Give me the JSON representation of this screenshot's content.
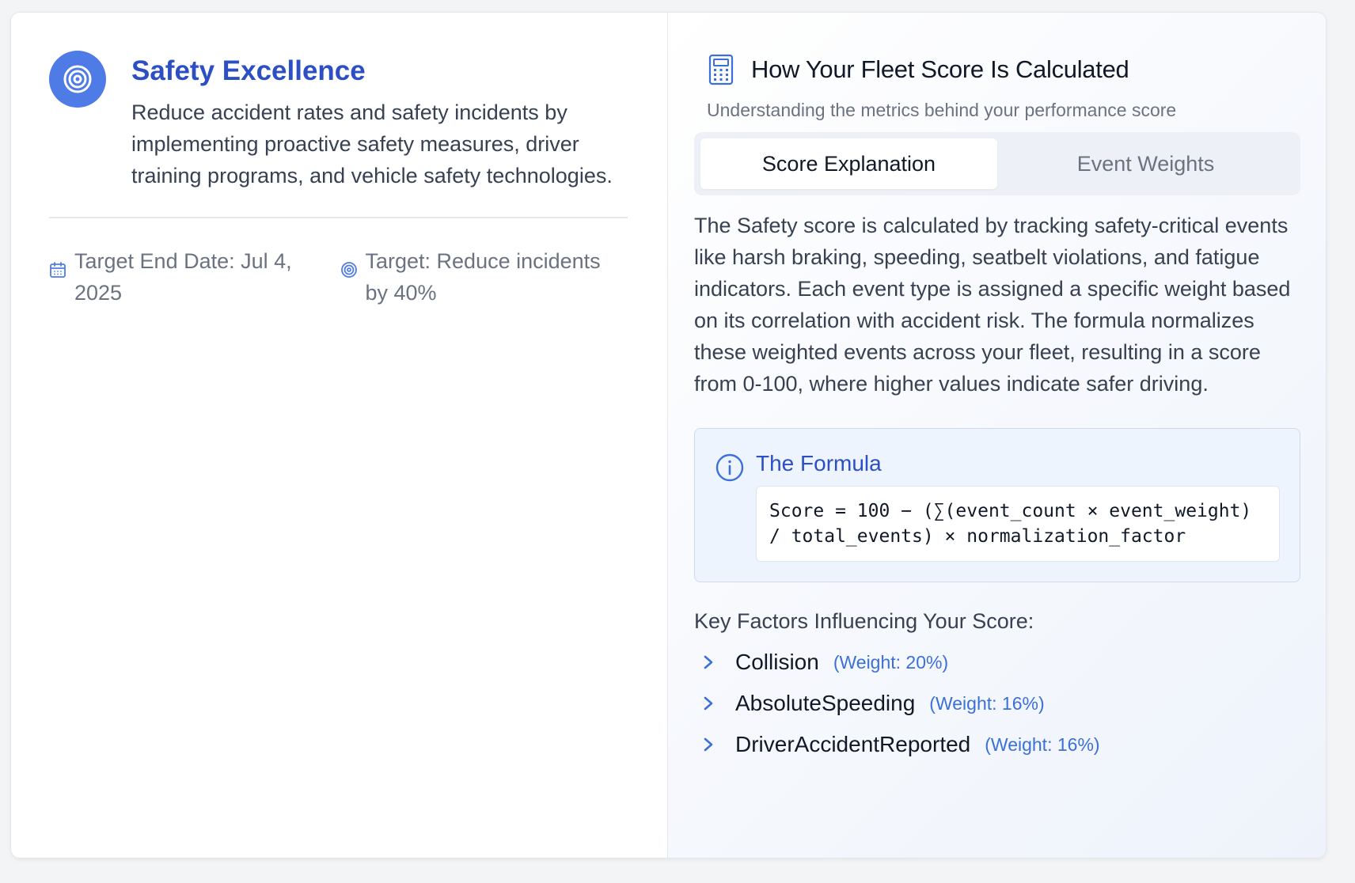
{
  "goal": {
    "title": "Safety Excellence",
    "description": "Reduce accident rates and safety incidents by implementing proactive safety measures, driver training programs, and vehicle safety technologies.",
    "icon": "target-icon",
    "target_end_date": "Target End Date: Jul 4, 2025",
    "target": "Target: Reduce incidents by 40%"
  },
  "calculation": {
    "title": "How Your Fleet Score Is Calculated",
    "subtitle": "Understanding the metrics behind your performance score",
    "tabs": [
      {
        "label": "Score Explanation",
        "active": true
      },
      {
        "label": "Event Weights",
        "active": false
      }
    ],
    "explanation": "The Safety score is calculated by tracking safety-critical events like harsh braking, speeding, seatbelt violations, and fatigue indicators. Each event type is assigned a specific weight based on its correlation with accident risk. The formula normalizes these weighted events across your fleet, resulting in a score from 0-100, where higher values indicate safer driving.",
    "formula": {
      "title": "The Formula",
      "code": "Score = 100 − (∑(event_count × event_weight) / total_events) × normalization_factor"
    },
    "factors_title": "Key Factors Influencing Your Score:",
    "factors": [
      {
        "name": "Collision",
        "weight": "(Weight: 20%)"
      },
      {
        "name": "AbsoluteSpeeding",
        "weight": "(Weight: 16%)"
      },
      {
        "name": "DriverAccidentReported",
        "weight": "(Weight: 16%)"
      }
    ]
  },
  "colors": {
    "accent": "#2c4fc4",
    "icon_blue": "#4f7be6",
    "weight_blue": "#3b6fd9"
  }
}
